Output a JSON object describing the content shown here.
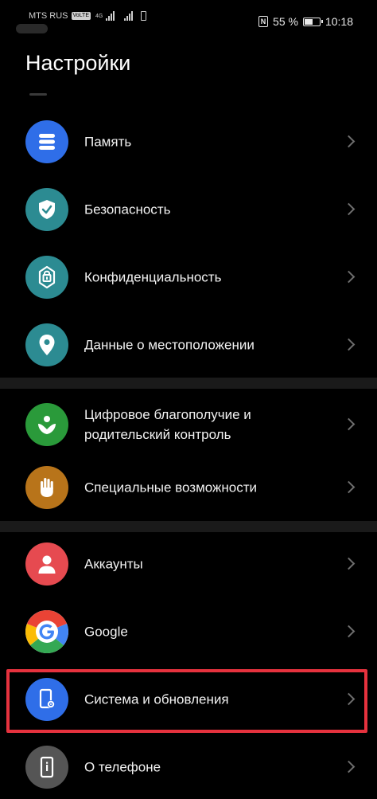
{
  "status_bar": {
    "carrier": "MTS RUS",
    "carrier_badge": "VoLTE",
    "network_type": "4G",
    "battery_percent": "55 %",
    "time": "10:18"
  },
  "page": {
    "title": "Настройки"
  },
  "settings": [
    {
      "label": "Память",
      "icon": "storage-icon",
      "color": "#2f6ee8"
    },
    {
      "label": "Безопасность",
      "icon": "shield-check-icon",
      "color": "#2c8b92"
    },
    {
      "label": "Конфиденциальность",
      "icon": "lock-info-icon",
      "color": "#2c8b92"
    },
    {
      "label": "Данные о местоположении",
      "icon": "location-pin-icon",
      "color": "#2c8b92"
    },
    {
      "label": "Цифровое благополучие и родительский контроль",
      "icon": "wellbeing-icon",
      "color": "#2a9a3a"
    },
    {
      "label": "Специальные возможности",
      "icon": "hand-icon",
      "color": "#b8741a"
    },
    {
      "label": "Аккаунты",
      "icon": "person-icon",
      "color": "#e64a50"
    },
    {
      "label": "Google",
      "icon": "google-icon",
      "color": "#ffffff"
    },
    {
      "label": "Система и обновления",
      "icon": "system-phone-icon",
      "color": "#2f6ee8"
    },
    {
      "label": "О телефоне",
      "icon": "phone-info-icon",
      "color": "#555555"
    }
  ],
  "highlight": {
    "color": "#e6323e",
    "target": "Система и обновления"
  }
}
